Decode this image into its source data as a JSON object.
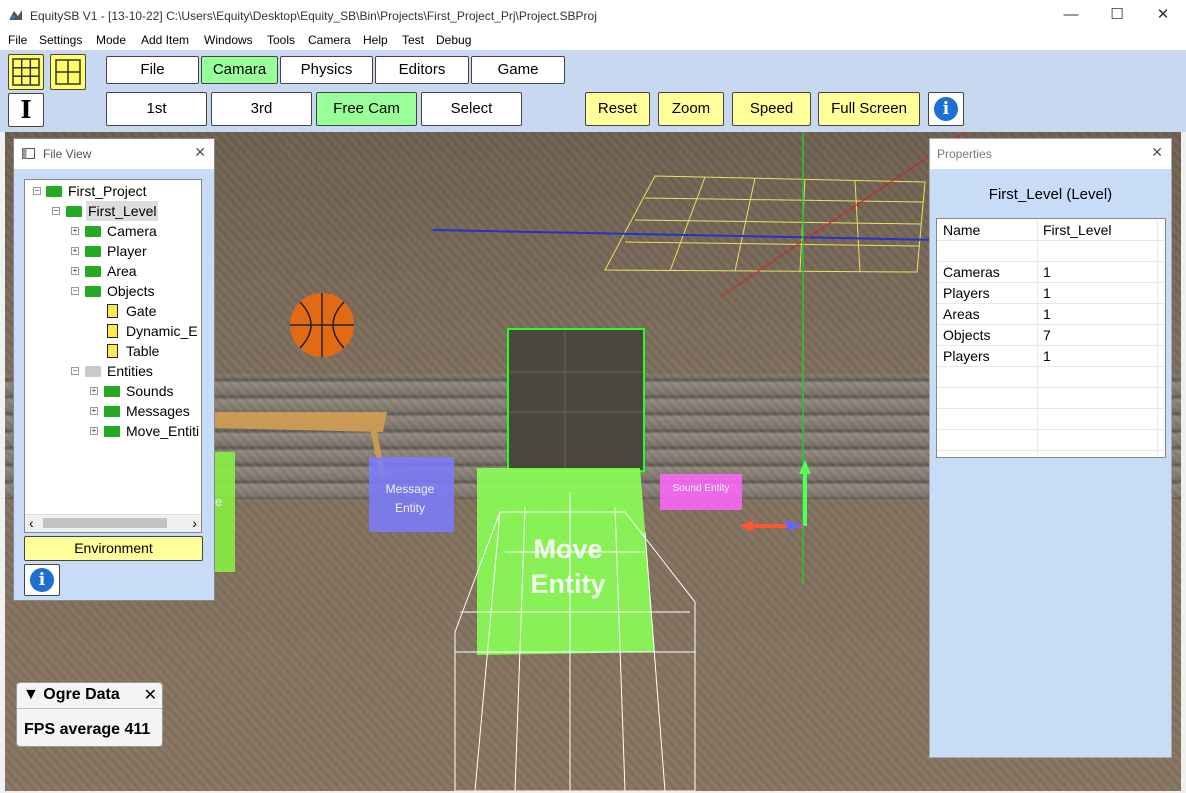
{
  "window": {
    "title": "EquitySB  V1 -  [13-10-22]    C:\\Users\\Equity\\Desktop\\Equity_SB\\Bin\\Projects\\First_Project_Prj\\Project.SBProj",
    "minimize": "—",
    "maximize": "☐",
    "close": "✕"
  },
  "menu": [
    "File",
    "Settings",
    "Mode",
    "Add Item",
    "Windows",
    "Tools",
    "Camera",
    "Help",
    "Test",
    "Debug"
  ],
  "toolbar": {
    "row1": [
      "File",
      "Camara",
      "Physics",
      "Editors",
      "Game"
    ],
    "row2": [
      "1st",
      "3rd",
      "Free Cam",
      "Select"
    ],
    "right": [
      "Reset",
      "Zoom",
      "Speed",
      "Full Screen"
    ],
    "info": "i",
    "text_tool": "I"
  },
  "file_view": {
    "title": "File View",
    "close": "✕",
    "tree": [
      {
        "label": "First_Project"
      },
      {
        "label": "First_Level"
      },
      {
        "label": "Camera"
      },
      {
        "label": "Player"
      },
      {
        "label": "Area"
      },
      {
        "label": "Objects"
      },
      {
        "label": "Gate"
      },
      {
        "label": "Dynamic_E"
      },
      {
        "label": "Table"
      },
      {
        "label": "Entities"
      },
      {
        "label": "Sounds"
      },
      {
        "label": "Messages"
      },
      {
        "label": "Move_Entiti"
      }
    ],
    "scroll_left": "‹",
    "scroll_right": "›",
    "environment_button": "Environment",
    "info": "i"
  },
  "properties": {
    "title": "Properties",
    "close": "✕",
    "heading": "First_Level   (Level)",
    "rows": [
      {
        "name": "Name",
        "value": "First_Level"
      },
      {
        "name": "",
        "value": ""
      },
      {
        "name": "Cameras",
        "value": "1"
      },
      {
        "name": "Players",
        "value": "1"
      },
      {
        "name": "Areas",
        "value": "1"
      },
      {
        "name": "Objects",
        "value": "7"
      },
      {
        "name": "Players",
        "value": "1"
      }
    ]
  },
  "scene": {
    "message_entity": "Message Entity",
    "sound_entity": "Sound Entity",
    "move_entity": "Move Entity",
    "move_entity_line1": "Move",
    "move_entity_line2": "Entity",
    "left_entity_partial": "e"
  },
  "ogre_data": {
    "title": "▼ Ogre Data",
    "close": "✕",
    "fps": "FPS average 411"
  },
  "colors": {
    "toolbar_bg": "#c8d8f0",
    "green_button": "#99ff99",
    "yellow_button": "#ffff99",
    "panel_bg": "#c8dcf8"
  }
}
